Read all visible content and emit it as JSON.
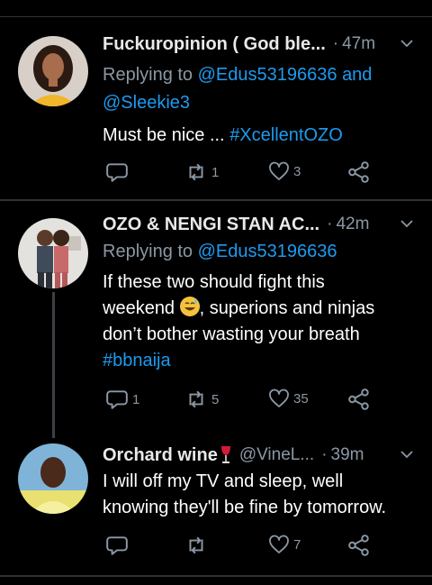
{
  "tweets": [
    {
      "name": "Fuckuropinion ( God ble...",
      "time": "47m",
      "replying_label": "Replying to",
      "mention1": "@Edus53196636",
      "mention_join": "and",
      "mention2": "@Sleekie3",
      "text": "Must be nice ...",
      "hashtag": "#XcellentOZO",
      "retweets": "1",
      "likes": "3"
    },
    {
      "name": "OZO & NENGI STAN AC...",
      "time": "42m",
      "replying_label": "Replying to",
      "mention1": "@Edus53196636",
      "line1": "If these two should fight this",
      "line2a": "weekend",
      "line2b": ", superions and ninjas",
      "line3": "don’t bother wasting your breath",
      "hashtag": "#bbnaija",
      "replies": "1",
      "retweets": "5",
      "likes": "35"
    },
    {
      "name": "Orchard wine",
      "handle": "@VineL...",
      "time": "39m",
      "line1": "I will off my TV and sleep, well",
      "line2": "knowing they'll be fine by tomorrow.",
      "likes": "7"
    }
  ],
  "separator": "·",
  "colors": {
    "accent": "#1d9bf0",
    "muted": "#8b98a5",
    "background": "#000000"
  }
}
